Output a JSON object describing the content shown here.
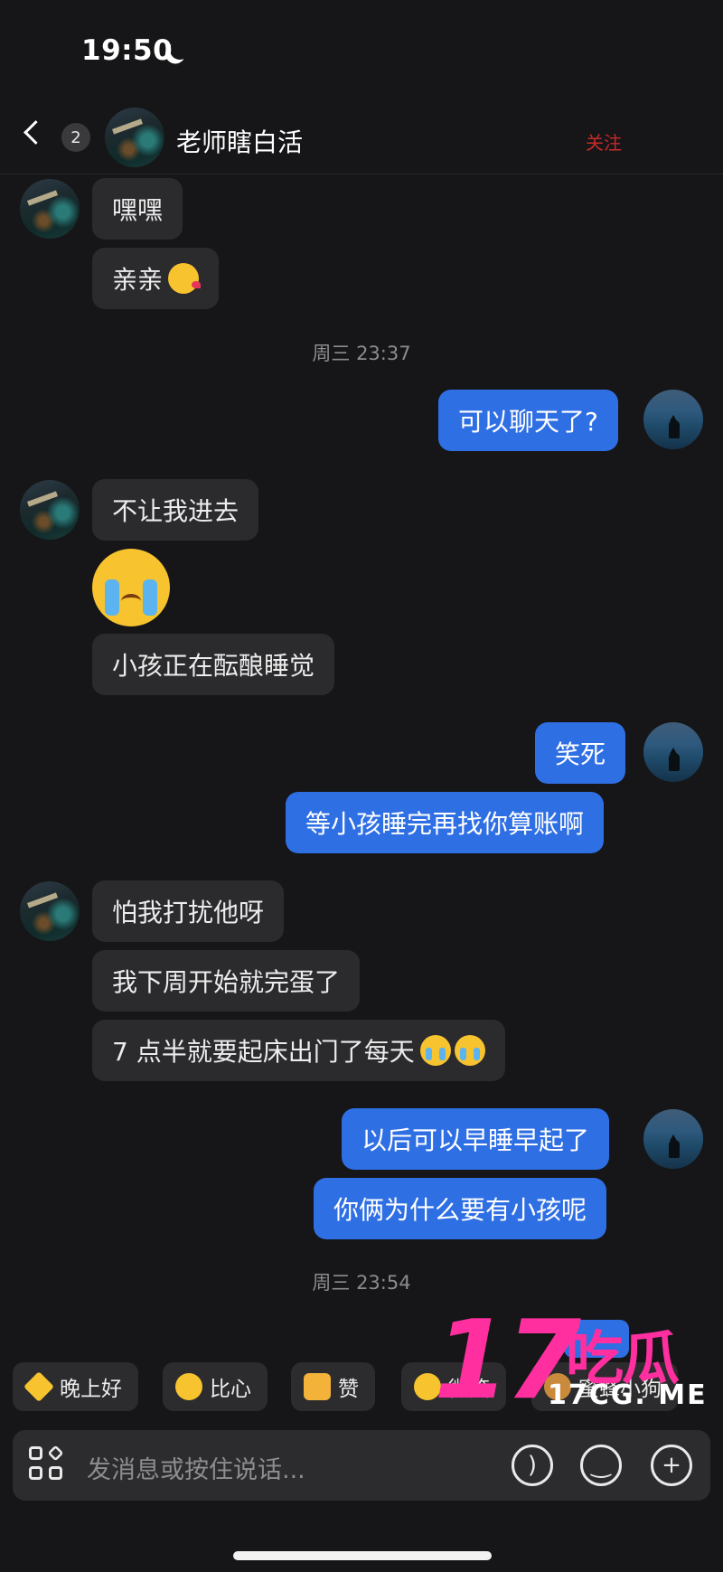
{
  "status_bar": {
    "time": "19:50",
    "icon": "moon-icon"
  },
  "header": {
    "unread_count": "2",
    "title": "老师瞎白活",
    "mark": "关注"
  },
  "messages": [
    {
      "side": "in",
      "text": "嘿嘿"
    },
    {
      "side": "in",
      "text": "亲亲",
      "emoji": "kiss-emoji"
    },
    {
      "timestamp": "周三 23:37"
    },
    {
      "side": "out",
      "text": "可以聊天了?"
    },
    {
      "side": "in",
      "text": "不让我进去"
    },
    {
      "side": "in",
      "emoji": "crying-emoji"
    },
    {
      "side": "in",
      "text": "小孩正在酝酿睡觉"
    },
    {
      "side": "out",
      "text": "笑死"
    },
    {
      "side": "out",
      "text": "等小孩睡完再找你算账啊"
    },
    {
      "side": "in",
      "text": "怕我打扰他呀"
    },
    {
      "side": "in",
      "text": "我下周开始就完蛋了"
    },
    {
      "side": "in",
      "text": "7 点半就要起床出门了每天",
      "emoji": "crying-emoji x2"
    },
    {
      "side": "out",
      "text": "以后可以早睡早起了"
    },
    {
      "side": "out",
      "text": "你俩为什么要有小孩呢"
    },
    {
      "timestamp": "周三 23:54"
    }
  ],
  "quick_replies": [
    "晚上好",
    "比心",
    "赞",
    "微笑",
    "蜜蜂小狗"
  ],
  "input": {
    "placeholder": "发消息或按住说话..."
  },
  "watermark": {
    "number": "17",
    "chinese": "吃瓜",
    "site": "17CG. ME"
  },
  "colors": {
    "background": "#161618",
    "incoming": "#2b2b2e",
    "outgoing": "#2f6fe4",
    "watermark": "#ff2fa0"
  }
}
